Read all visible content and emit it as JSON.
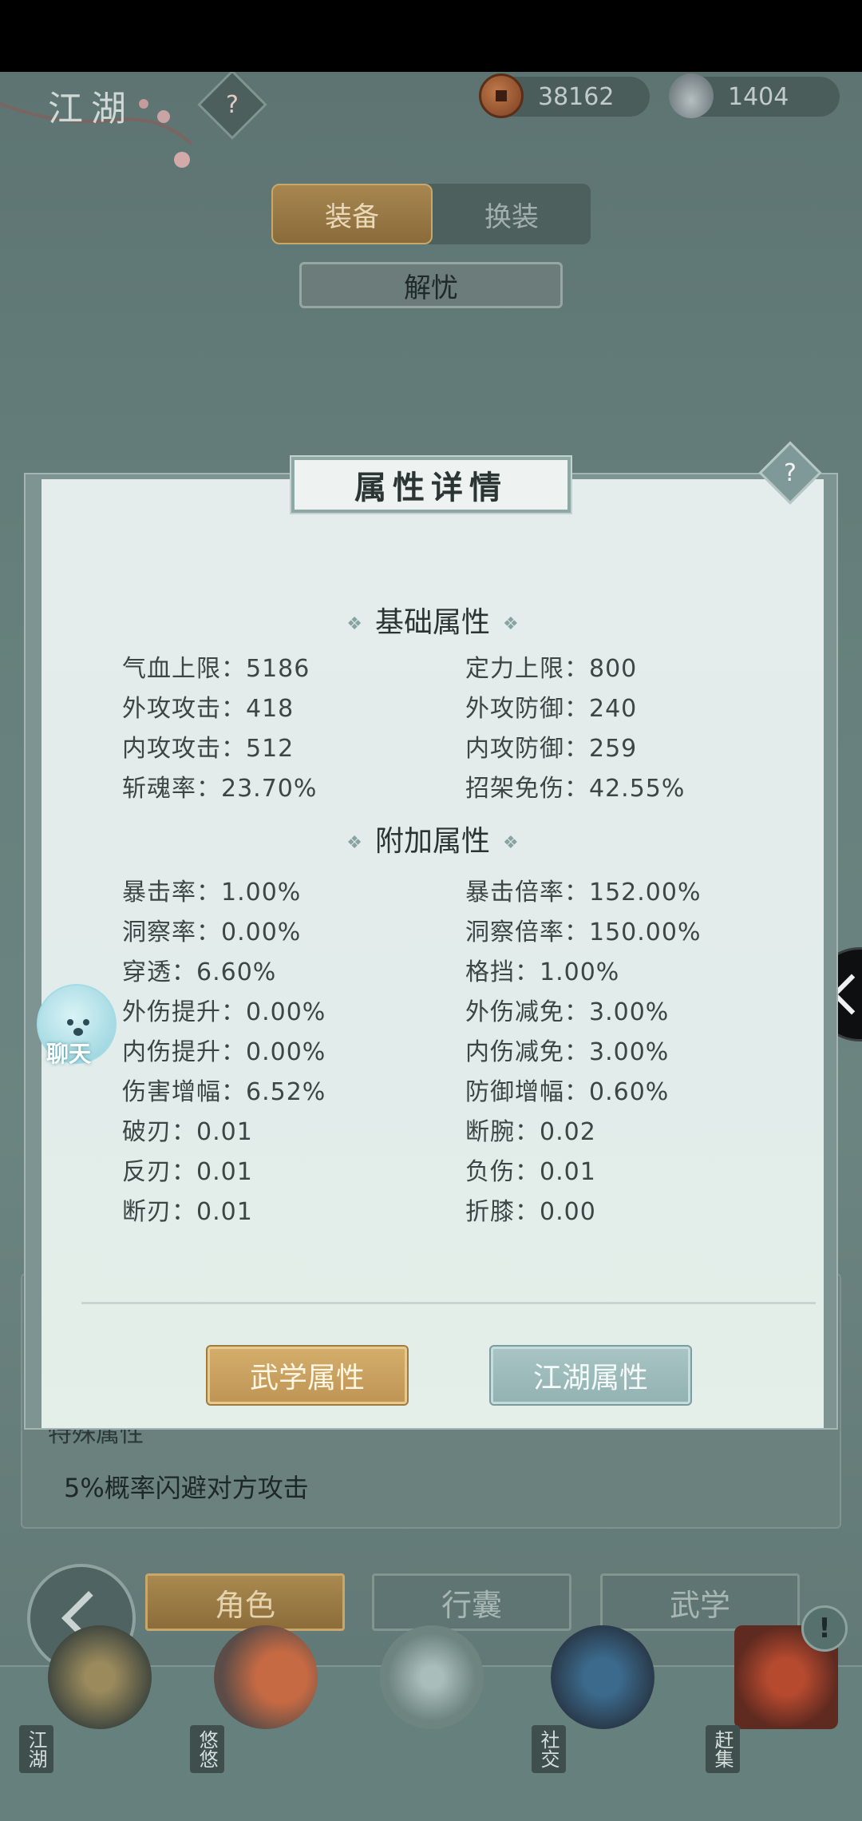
{
  "header": {
    "title": "江湖",
    "help_glyph": "?",
    "coins": "38162",
    "silver": "1404"
  },
  "equip_tabs": [
    {
      "label": "装备",
      "active": true
    },
    {
      "label": "换装",
      "active": false
    }
  ],
  "character_name": "解忧",
  "modal": {
    "title": "属性详情",
    "help_glyph": "?",
    "basic_title": "基础属性",
    "basic_attrs": [
      {
        "left": "气血上限：5186",
        "right": "定力上限：800"
      },
      {
        "left": "外攻攻击：418",
        "right": "外攻防御：240"
      },
      {
        "left": "内攻攻击：512",
        "right": "内攻防御：259"
      },
      {
        "left": "斩魂率：23.70%",
        "right": "招架免伤：42.55%"
      }
    ],
    "extra_title": "附加属性",
    "extra_attrs": [
      {
        "left": "暴击率：1.00%",
        "right": "暴击倍率：152.00%"
      },
      {
        "left": "洞察率：0.00%",
        "right": "洞察倍率：150.00%"
      },
      {
        "left": "穿透：6.60%",
        "right": "格挡：1.00%"
      },
      {
        "left": "外伤提升：0.00%",
        "right": "外伤减免：3.00%"
      },
      {
        "left": "内伤提升：0.00%",
        "right": "内伤减免：3.00%"
      },
      {
        "left": "伤害增幅：6.52%",
        "right": "防御增幅：0.60%"
      },
      {
        "left": "破刃：0.01",
        "right": "断腕：0.02"
      },
      {
        "left": "反刃：0.01",
        "right": "负伤：0.01"
      },
      {
        "left": "断刃：0.01",
        "right": "折膝：0.00"
      }
    ],
    "btn_martial": "武学属性",
    "btn_jianghu": "江湖属性"
  },
  "chat_label": "聊天",
  "special": {
    "title": "特殊属性",
    "desc": "5%概率闪避对方攻击"
  },
  "nav_buttons": [
    {
      "label": "角色",
      "active": true
    },
    {
      "label": "行囊",
      "active": false
    },
    {
      "label": "武学",
      "active": false
    }
  ],
  "dock": [
    {
      "label": "江湖"
    },
    {
      "label": "悠悠"
    },
    {
      "label": "社交"
    },
    {
      "label": "赶集"
    }
  ],
  "dock_alert": "!",
  "colors": {
    "gold": "#bf9555",
    "teal": "#93b2b2",
    "panel": "#e2ecea",
    "bg": "#667f7c"
  }
}
